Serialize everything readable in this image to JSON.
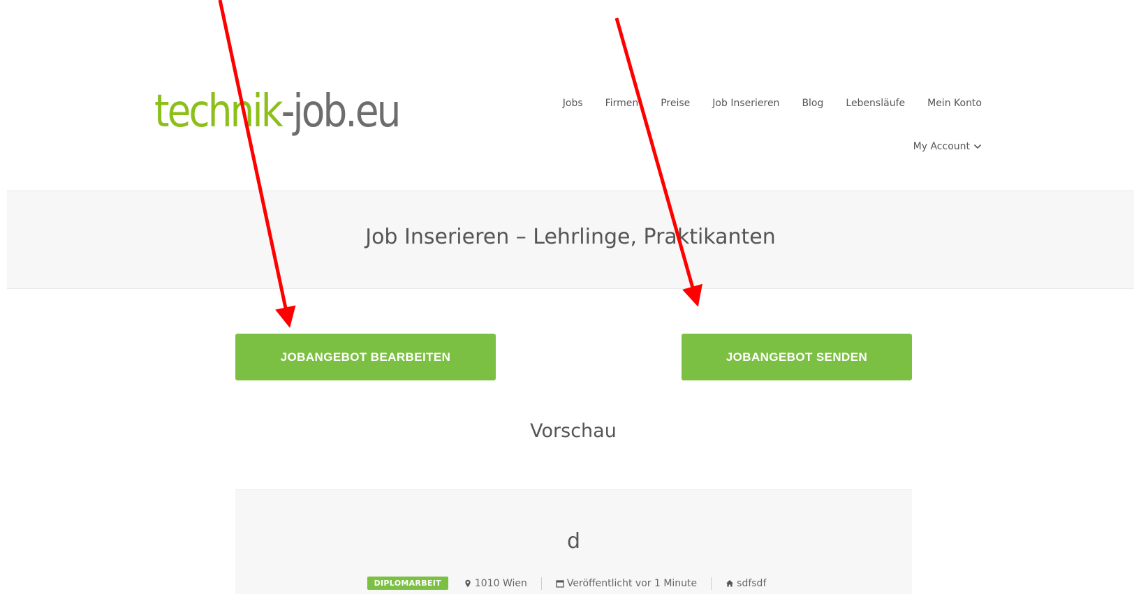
{
  "header": {
    "logo_part_a": "technik",
    "logo_part_b": "-job.eu",
    "nav": [
      "Jobs",
      "Firmen",
      "Preise",
      "Job Inserieren",
      "Blog",
      "Lebensläufe",
      "Mein Konto"
    ],
    "account_label": "My Account"
  },
  "page": {
    "title": "Job Inserieren – Lehrlinge, Praktikanten"
  },
  "actions": {
    "edit_label": "JOBANGEBOT BEARBEITEN",
    "send_label": "JOBANGEBOT SENDEN"
  },
  "preview": {
    "heading": "Vorschau",
    "job_title": "d",
    "job_type": "DIPLOMARBEIT",
    "location": "1010 Wien",
    "published": "Veröffentlicht vor 1 Minute",
    "company": "sdfsdf"
  },
  "colors": {
    "accent_green": "#7bc043",
    "logo_green": "#8cbf1a",
    "logo_gray": "#6d6d6d",
    "annotation_red": "#ff0000"
  }
}
